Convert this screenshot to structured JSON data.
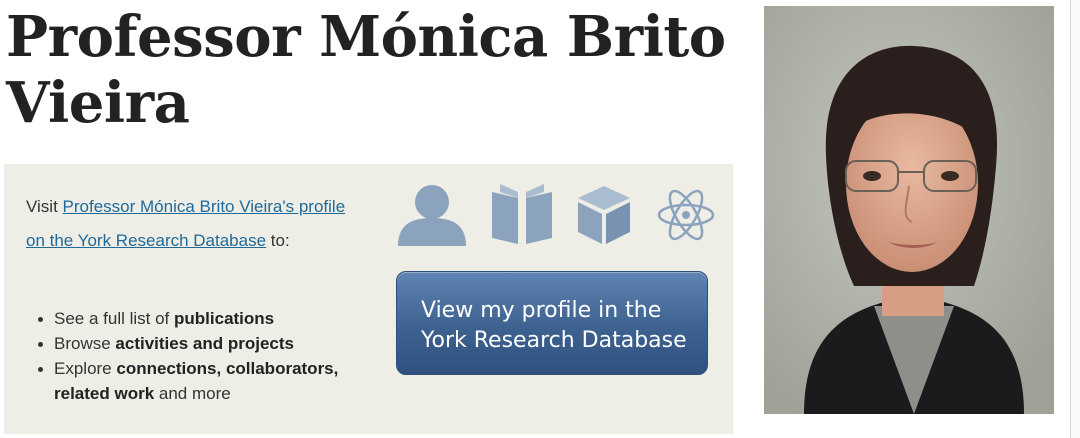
{
  "page": {
    "title": "Professor Mónica Brito Vieira"
  },
  "research_panel": {
    "visit_prefix": "Visit ",
    "profile_link": "Professor Mónica Brito Vieira's profile on the York Research Database",
    "visit_suffix": " to:",
    "benefits": [
      {
        "prefix": "See a full list of ",
        "bold": "publications",
        "suffix": ""
      },
      {
        "prefix": "Browse ",
        "bold": "activities and projects",
        "suffix": ""
      },
      {
        "prefix": "Explore ",
        "bold": "connections, collaborators, related work",
        "suffix": " and more"
      }
    ],
    "icons": [
      "person-icon",
      "book-icon",
      "cube-icon",
      "atom-icon"
    ],
    "button_line1": "View my profile in the",
    "button_line2": "York Research Database"
  },
  "colors": {
    "panel_bg": "#eeeee6",
    "link": "#1f6a9a",
    "button": "#3e628f",
    "icon": "#8ba3bd"
  }
}
